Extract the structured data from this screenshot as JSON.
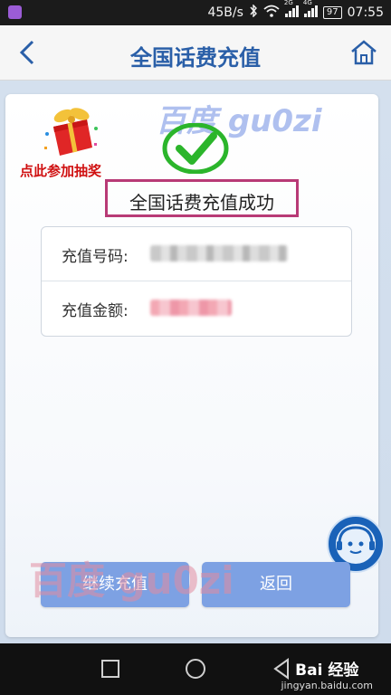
{
  "status_bar": {
    "speed": "45B/s",
    "network_2g": "2G",
    "network_4g": "4G",
    "battery": "97",
    "time": "07:55"
  },
  "header": {
    "title": "全国话费充值"
  },
  "lottery": {
    "label": "点此参加抽奖"
  },
  "result": {
    "message": "全国话费充值成功"
  },
  "details": {
    "number_label": "充值号码:",
    "amount_label": "充值金额:"
  },
  "buttons": {
    "continue": "继续充值",
    "return": "返回"
  },
  "watermark": {
    "top": "百度 gu0zi",
    "bottom": "百度 gu0zi"
  },
  "footer_brand": {
    "name": "Bai 经验",
    "url": "jingyan.baidu.com"
  },
  "colors": {
    "title": "#2a5fa8",
    "button": "#7da1e3",
    "success_check": "#2bb52b",
    "highlight_box": "#b83a76",
    "lottery_text": "#d01010"
  }
}
